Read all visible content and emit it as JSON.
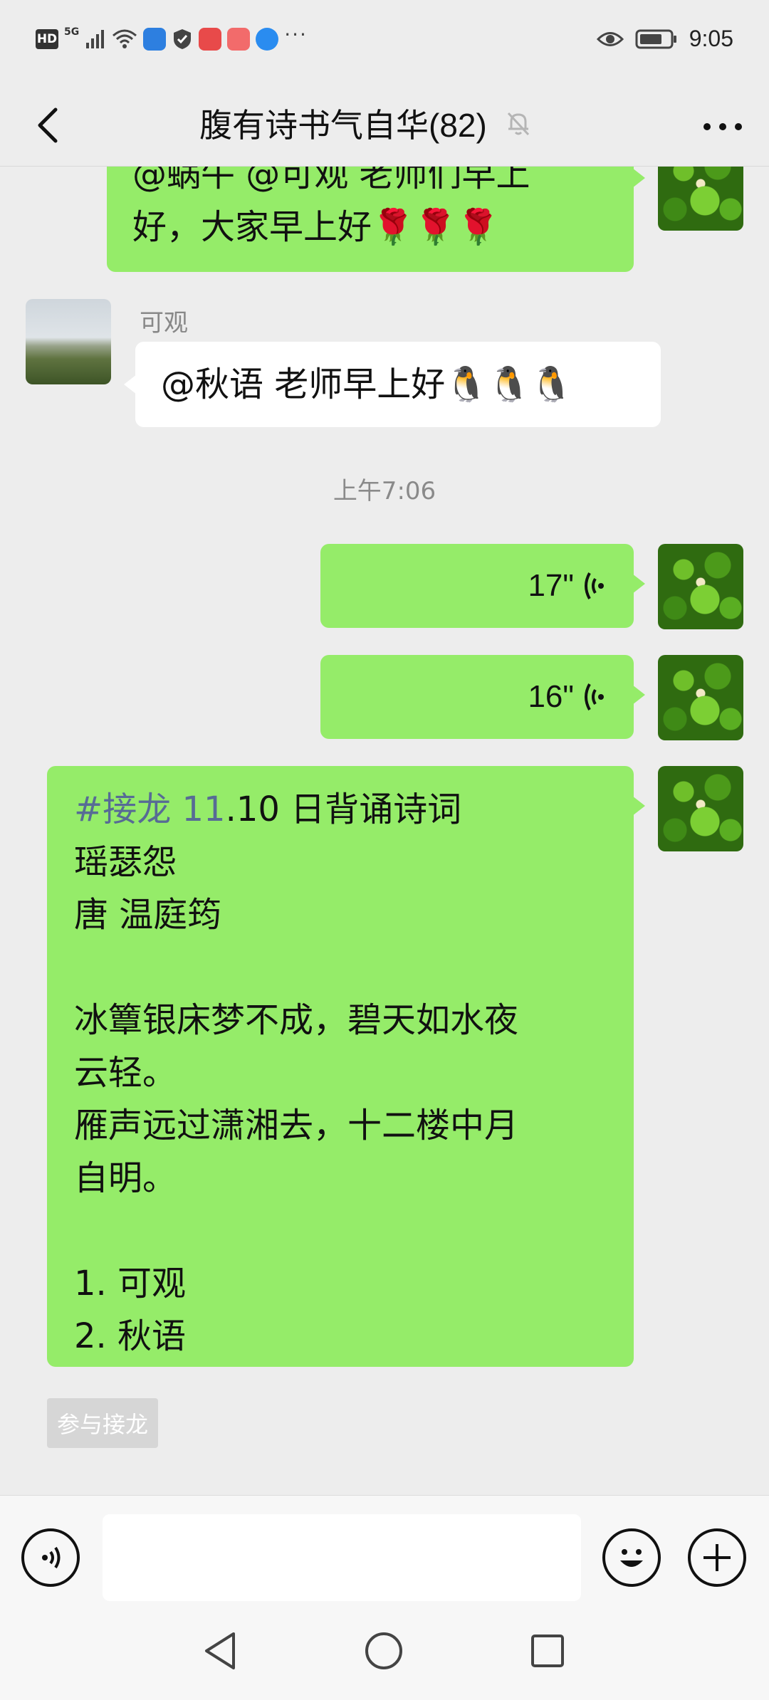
{
  "status_bar": {
    "hd_label": "HD",
    "signal_label": "5G",
    "time": "9:05",
    "more_indicator": "···"
  },
  "header": {
    "title": "腹有诗书气自华(82)"
  },
  "messages": {
    "m1": {
      "line1": "@蜗牛  @可观  老师们早上",
      "line2": "好，大家早上好🌹🌹🌹"
    },
    "m2": {
      "sender": "可观",
      "text": "@秋语  老师早上好🐧🐧🐧"
    },
    "timestamp": "上午7:06",
    "voice1": {
      "duration": "17\""
    },
    "voice2": {
      "duration": "16\""
    },
    "solitaire": {
      "hashtag": "#接龙 11",
      "heading_rest": ".10 日背诵诗词",
      "body": "瑶瑟怨\n唐 温庭筠\n\n冰簟银床梦不成，碧天如水夜\n云轻。\n雁声远过潇湘去，十二楼中月\n自明。\n\n1. 可观\n2. 秋语"
    },
    "join_button": "参与接龙"
  },
  "input_bar": {
    "placeholder": ""
  },
  "colors": {
    "background": "#ededed",
    "bubble_green": "#95ec69",
    "bubble_white": "#ffffff",
    "hashtag": "#576b95"
  },
  "icons": [
    "back-arrow-icon",
    "mute-bell-icon",
    "more-dots-icon",
    "voice-mode-icon",
    "emoji-icon",
    "plus-icon",
    "nav-back-icon",
    "nav-home-icon",
    "nav-recents-icon"
  ]
}
